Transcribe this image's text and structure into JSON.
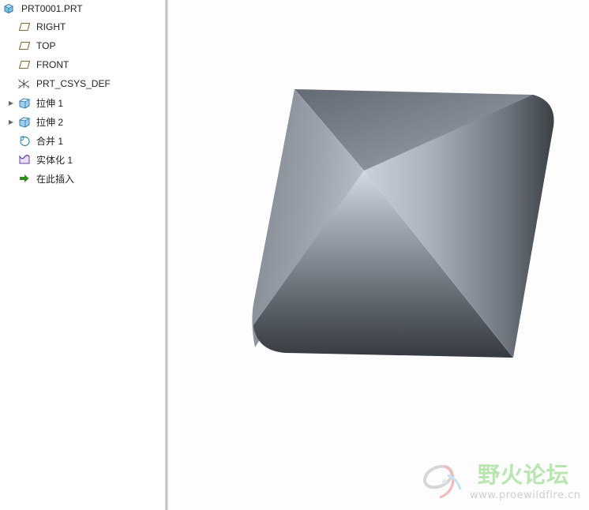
{
  "model_tree": {
    "root": {
      "label": "PRT0001.PRT",
      "icon": "part-icon"
    },
    "items": [
      {
        "label": "RIGHT",
        "icon": "datum-plane-icon",
        "expandable": false
      },
      {
        "label": "TOP",
        "icon": "datum-plane-icon",
        "expandable": false
      },
      {
        "label": "FRONT",
        "icon": "datum-plane-icon",
        "expandable": false
      },
      {
        "label": "PRT_CSYS_DEF",
        "icon": "coordinate-system-icon",
        "expandable": false
      },
      {
        "label": "拉伸 1",
        "icon": "extrude-icon",
        "expandable": true
      },
      {
        "label": "拉伸 2",
        "icon": "extrude-icon",
        "expandable": true
      },
      {
        "label": "合并 1",
        "icon": "merge-icon",
        "expandable": false
      },
      {
        "label": "实体化 1",
        "icon": "solidify-icon",
        "expandable": false
      },
      {
        "label": "在此插入",
        "icon": "insert-here-arrow-icon",
        "expandable": false
      }
    ]
  },
  "watermark": {
    "name": "野火论坛",
    "url": "www.proewildfire.cn"
  },
  "colors": {
    "tree_background": "#ffffff",
    "viewport_background": "#fdfdfd",
    "datum_plane": "#8a6a3a",
    "insert_arrow": "#2e8b1e",
    "model_shade_dark": "#3a3e44",
    "model_shade_light": "#c9d2dc"
  }
}
